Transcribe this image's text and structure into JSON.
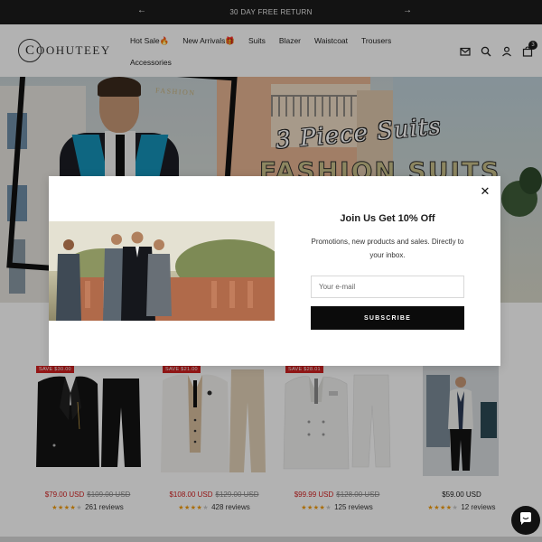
{
  "announcement": {
    "text": "30 DAY FREE RETURN",
    "prev_icon": "arrow-left-icon",
    "next_icon": "arrow-right-icon"
  },
  "header": {
    "logo_mark": "C",
    "logo_text": "OOHUTEEY",
    "nav": [
      {
        "label": "Hot Sale🔥"
      },
      {
        "label": "New Arrivals🎁"
      },
      {
        "label": "Suits"
      },
      {
        "label": "Blazer"
      },
      {
        "label": "Waistcoat"
      },
      {
        "label": "Trousers"
      },
      {
        "label": "Accessories"
      }
    ],
    "icons": [
      "mail-icon",
      "search-icon",
      "account-icon",
      "cart-icon"
    ],
    "cart_count": "3"
  },
  "hero": {
    "script_title": "3 Piece Suits",
    "big_title": "FASHION SUITS",
    "poster_label": "FASHION"
  },
  "popup": {
    "title": "Join Us Get 10% Off",
    "description": "Promotions, new products and sales. Directly to your inbox.",
    "email_placeholder": "Your e-mail",
    "button_label": "SUBSCRIBE",
    "close_icon": "close-icon"
  },
  "products": [
    {
      "badge": "SAVE $30.00",
      "price": "$79.00 USD",
      "compare_price": "$109.00 USD",
      "rating": 4.5,
      "reviews": "261 reviews",
      "on_sale": true
    },
    {
      "badge": "SAVE $21.00",
      "price": "$108.00 USD",
      "compare_price": "$129.00 USD",
      "rating": 4.5,
      "reviews": "428 reviews",
      "on_sale": true
    },
    {
      "badge": "SAVE $28.01",
      "price": "$99.99 USD",
      "compare_price": "$128.00 USD",
      "rating": 4.5,
      "reviews": "125 reviews",
      "on_sale": true
    },
    {
      "badge": "",
      "price": "$59.00 USD",
      "compare_price": "",
      "rating": 4,
      "reviews": "12 reviews",
      "on_sale": false
    }
  ],
  "chat": {
    "icon": "chat-icon"
  },
  "colors": {
    "sale_red": "#d42020",
    "star_orange": "#f29b0a",
    "announce_bg": "#1c1c1c",
    "hero_teal": "#1593b9"
  }
}
